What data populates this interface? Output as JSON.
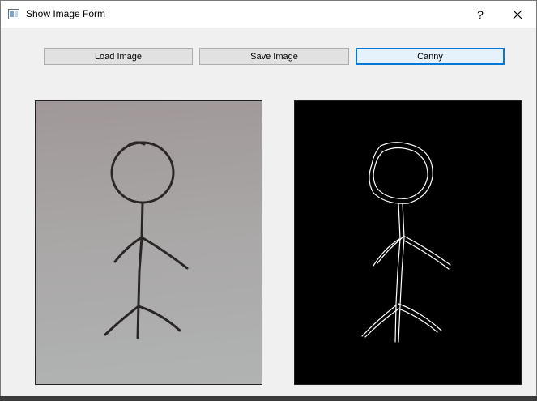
{
  "window": {
    "title": "Show Image Form",
    "help_glyph": "?",
    "close_glyph": "✕"
  },
  "toolbar": {
    "load_label": "Load Image",
    "save_label": "Save Image",
    "canny_label": "Canny"
  },
  "colors": {
    "accent": "#0078d7",
    "canny_background": "#000000",
    "canny_edges": "#ffffff",
    "ink": "#2a2526"
  },
  "images": {
    "original": {
      "icon": "stick-figure-photo"
    },
    "canny": {
      "icon": "stick-figure-edges"
    }
  }
}
